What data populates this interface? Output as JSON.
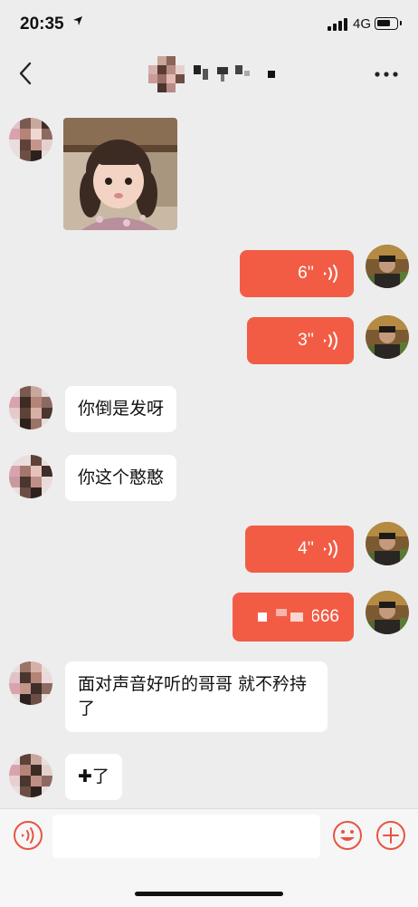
{
  "status_bar": {
    "time": "20:35",
    "network": "4G",
    "icons": [
      "location-arrow-icon",
      "signal-icon",
      "battery-icon"
    ]
  },
  "nav": {
    "title": "",
    "icons": [
      "chevron-left-icon",
      "more-icon"
    ]
  },
  "messages": [
    {
      "side": "in",
      "type": "image"
    },
    {
      "side": "out",
      "type": "voice",
      "duration": "6''"
    },
    {
      "side": "out",
      "type": "voice",
      "duration": "3''"
    },
    {
      "side": "in",
      "type": "text",
      "text": "你倒是发呀"
    },
    {
      "side": "in",
      "type": "text",
      "text": "你这个憨憨"
    },
    {
      "side": "out",
      "type": "voice",
      "duration": "4''"
    },
    {
      "side": "out",
      "type": "text",
      "text": "666"
    },
    {
      "side": "in",
      "type": "text",
      "text": "面对声音好听的哥哥 就不矜持了"
    },
    {
      "side": "in",
      "type": "text",
      "text": "✚了"
    }
  ],
  "input_bar": {
    "value": "",
    "icons": [
      "voice-icon",
      "emoji-icon",
      "plus-icon"
    ]
  },
  "colors": {
    "outgoing_bubble": "#f25c45",
    "incoming_bubble": "#ffffff",
    "chat_background": "#ededed",
    "accent_icon": "#e8543f"
  }
}
